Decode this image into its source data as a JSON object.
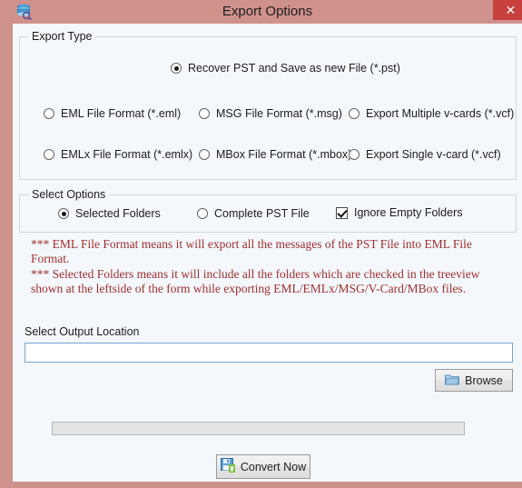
{
  "window": {
    "title": "Export Options",
    "app_icon": "pst-stack-icon",
    "close_label": "✕",
    "titlebar_color": "#cf918c",
    "close_button_color": "#c8413f",
    "client_background": "#f4f7fb"
  },
  "export_type": {
    "legend": "Export Type",
    "options": [
      {
        "label": "Recover PST and Save as new File (*.pst)",
        "selected": true
      },
      {
        "label": "EML File  Format (*.eml)",
        "selected": false
      },
      {
        "label": "MSG File Format (*.msg)",
        "selected": false
      },
      {
        "label": "Export Multiple v-cards (*.vcf)",
        "selected": false
      },
      {
        "label": "EMLx File  Format (*.emlx)",
        "selected": false
      },
      {
        "label": "MBox File Format (*.mbox)",
        "selected": false
      },
      {
        "label": "Export Single v-card (*.vcf)",
        "selected": false
      }
    ]
  },
  "select_options": {
    "legend": "Select Options",
    "radios": [
      {
        "label": "Selected Folders",
        "selected": true
      },
      {
        "label": "Complete PST File",
        "selected": false
      }
    ],
    "checkbox": {
      "label": "Ignore Empty Folders",
      "checked": true
    }
  },
  "notes": {
    "color": "#a03030",
    "line_1": "*** EML File Format means it will export all the messages of the PST File into EML File Format.",
    "line_2": "*** Selected Folders means it will include all the folders which are checked in the treeview shown at the leftside of the form while exporting EML/EMLx/MSG/V-Card/MBox files."
  },
  "output": {
    "label": "Select Output Location",
    "value": "",
    "placeholder": "",
    "browse_label": "Browse",
    "browse_icon": "folder-icon"
  },
  "progress": {
    "percent": 0
  },
  "convert": {
    "label": "Convert Now",
    "icon": "save-disk-icon"
  }
}
